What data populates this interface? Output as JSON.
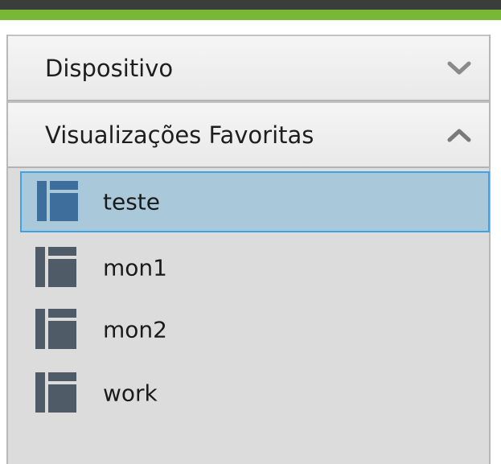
{
  "sections": {
    "device": {
      "title": "Dispositivo",
      "state": "collapsed"
    },
    "favorites": {
      "title": "Visualizações Favoritas",
      "state": "expanded"
    }
  },
  "favorites_list": [
    {
      "label": "teste",
      "selected": true,
      "icon": "view-layout-icon"
    },
    {
      "label": "mon1",
      "selected": false,
      "icon": "view-layout-icon"
    },
    {
      "label": "mon2",
      "selected": false,
      "icon": "view-layout-icon"
    },
    {
      "label": "work",
      "selected": false,
      "icon": "view-layout-icon"
    }
  ],
  "colors": {
    "accent_green": "#79b836",
    "selection_bg": "#a9c8d9",
    "selection_border": "#3da3e6",
    "icon_normal": "#4f5b67",
    "icon_selected": "#3e6f9c"
  }
}
